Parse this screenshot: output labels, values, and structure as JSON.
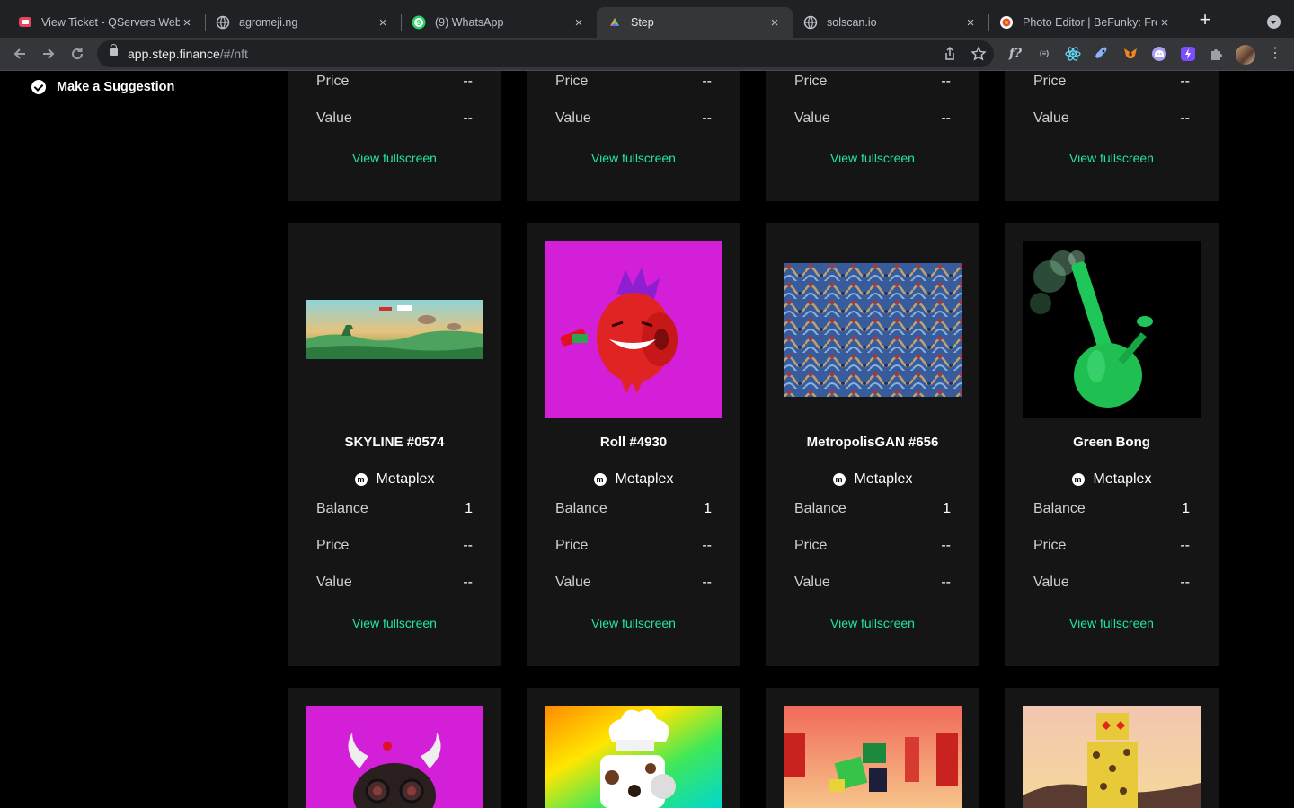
{
  "browser": {
    "tabs": [
      {
        "title": "View Ticket - QServers Web Hosting",
        "close": "×"
      },
      {
        "title": "agromeji.ng",
        "close": "×"
      },
      {
        "title": "(9) WhatsApp",
        "close": "×"
      },
      {
        "title": "Step",
        "close": "×"
      },
      {
        "title": "solscan.io",
        "close": "×"
      },
      {
        "title": "Photo Editor | BeFunky: Free",
        "close": "×"
      }
    ],
    "new_tab": "+",
    "url_host": "app.step.finance",
    "url_path": "/#/nft"
  },
  "sidebar": {
    "suggestion_label": "Make a Suggestion"
  },
  "labels": {
    "balance": "Balance",
    "price": "Price",
    "value": "Value",
    "view_fullscreen": "View fullscreen"
  },
  "top_row": [
    {
      "price": "--",
      "value": "--"
    },
    {
      "price": "--",
      "value": "--"
    },
    {
      "price": "--",
      "value": "--"
    },
    {
      "price": "--",
      "value": "--"
    }
  ],
  "nfts": [
    {
      "name": "SKYLINE #0574",
      "platform": "Metaplex",
      "balance": "1",
      "price": "--",
      "value": "--",
      "image": "pixel-dinosaur-landscape"
    },
    {
      "name": "Roll #4930",
      "platform": "Metaplex",
      "balance": "1",
      "price": "--",
      "value": "--",
      "image": "red-toilet-roll-character"
    },
    {
      "name": "MetropolisGAN #656",
      "platform": "Metaplex",
      "balance": "1",
      "price": "--",
      "value": "--",
      "image": "abstract-mosaic-painting"
    },
    {
      "name": "Green Bong",
      "platform": "Metaplex",
      "balance": "1",
      "price": "--",
      "value": "--",
      "image": "green-bong-smoke"
    }
  ],
  "bottom_row": [
    {
      "image": "horned-robot-head"
    },
    {
      "image": "chef-toilet-roll"
    },
    {
      "image": "voxel-character-sunset"
    },
    {
      "image": "voxel-leopard-robot"
    }
  ],
  "colors": {
    "accent": "#22e59a",
    "card_bg": "#151515",
    "page_bg": "#000000"
  }
}
